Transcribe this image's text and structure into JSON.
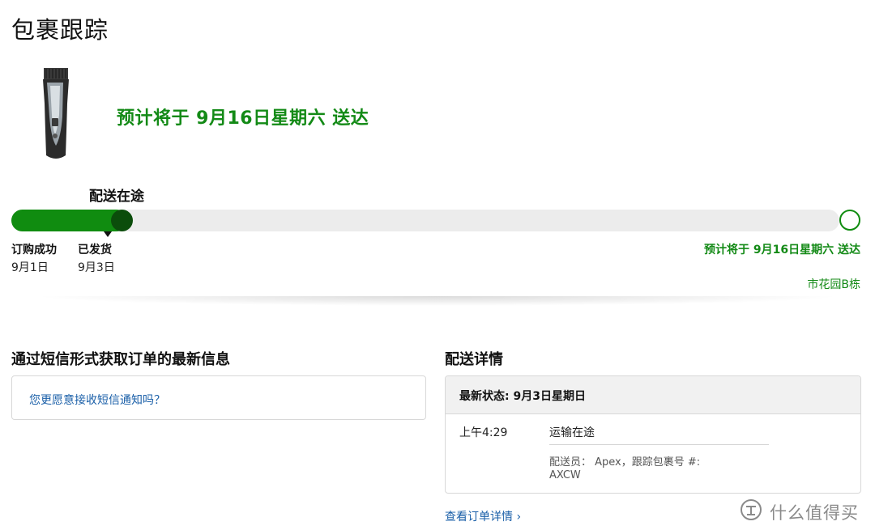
{
  "page_title": "包裹跟踪",
  "eta_headline": "预计将于 9月16日星期六 送达",
  "current_stage": "配送在途",
  "progress": {
    "fraction": 0.14,
    "knob_fraction": 0.12
  },
  "steps": [
    {
      "title": "订购成功",
      "date": "9月1日"
    },
    {
      "title": "已发货",
      "date": "9月3日"
    }
  ],
  "eta_right": "预计将于 9月16日星期六 送达",
  "address_right": "市花园B栋",
  "sms": {
    "section_title": "通过短信形式获取订单的最新信息",
    "prompt_link": "您更愿意接收短信通知吗？"
  },
  "delivery": {
    "section_title": "配送详情",
    "latest_status": "最新状态: 9月3日星期日",
    "events": [
      {
        "time": "上午4:29",
        "status": "运输在途",
        "carrier": "配送员： Apex，跟踪包裹号 #:",
        "tracking": "AXCW"
      }
    ],
    "order_link": "查看订单详情 ›"
  },
  "watermark": {
    "icon": "zhide-logo-icon",
    "text": "什么值得买"
  },
  "colors": {
    "accent_green": "#108c10",
    "knob": "#0b4d0b",
    "link_blue": "#1a5fa8"
  }
}
